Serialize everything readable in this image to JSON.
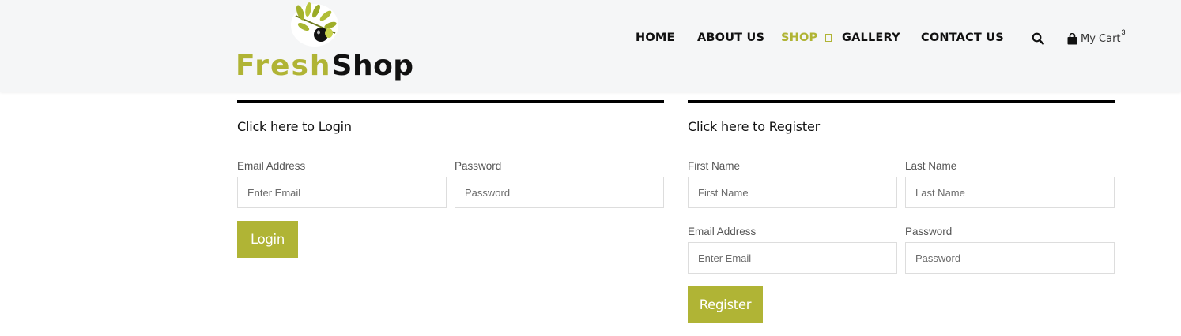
{
  "brand": {
    "fresh": "Fresh",
    "shop": "Shop",
    "accent": "#b0b435"
  },
  "nav": {
    "home": "HOME",
    "about": "ABOUT US",
    "shop": "SHOP",
    "gallery": "GALLERY",
    "contact": "CONTACT US"
  },
  "cart": {
    "label": "My Cart",
    "count": "3"
  },
  "icons": {
    "search": "search-icon",
    "cart": "shopping-bag-icon",
    "caret": "dropdown-caret-icon"
  },
  "login": {
    "title": "Click here to Login",
    "email_label": "Email Address",
    "email_placeholder": "Enter Email",
    "password_label": "Password",
    "password_placeholder": "Password",
    "button": "Login"
  },
  "register": {
    "title": "Click here to Register",
    "first_name_label": "First Name",
    "first_name_placeholder": "First Name",
    "last_name_label": "Last Name",
    "last_name_placeholder": "Last Name",
    "email_label": "Email Address",
    "email_placeholder": "Enter Email",
    "password_label": "Password",
    "password_placeholder": "Password",
    "button": "Register"
  }
}
